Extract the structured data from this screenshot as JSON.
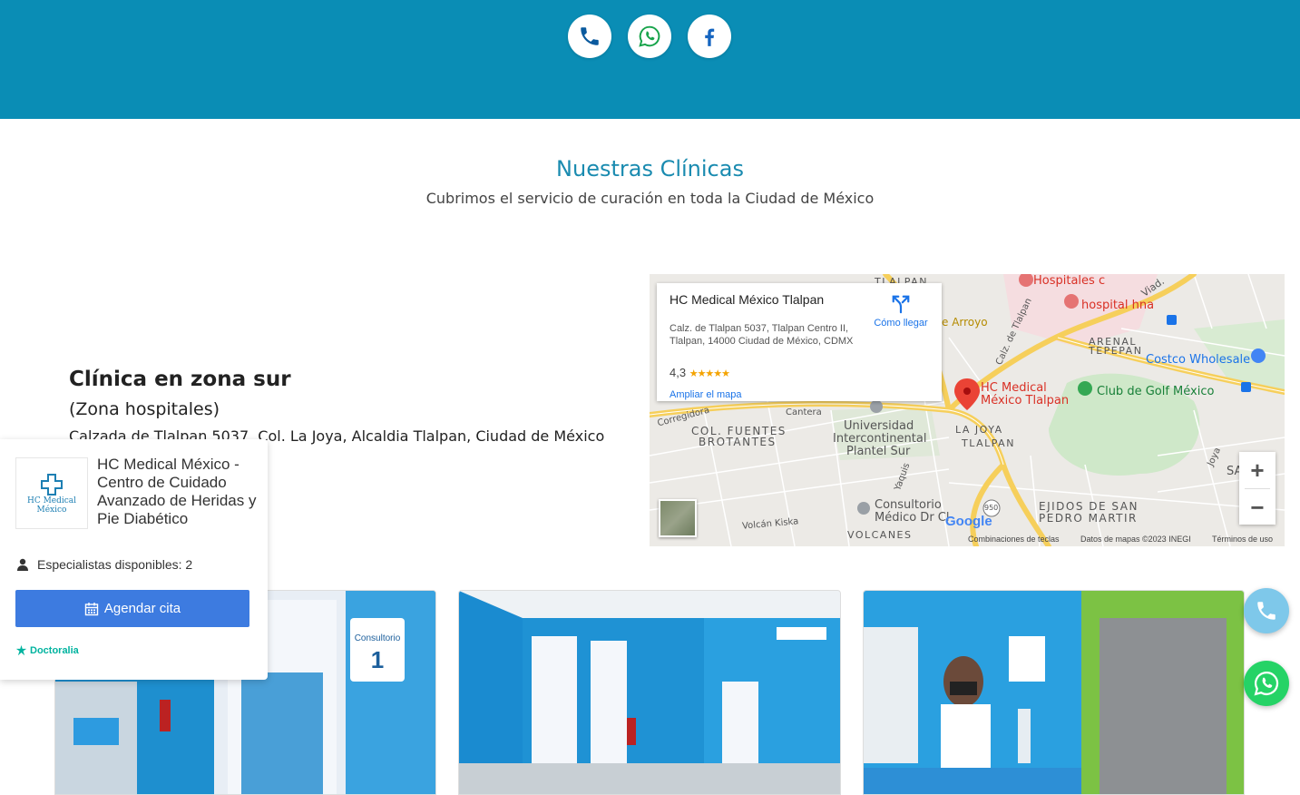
{
  "header": {
    "background_color": "#0a8db5",
    "social": [
      {
        "icon": "phone-icon",
        "label": "Teléfono"
      },
      {
        "icon": "whatsapp-icon",
        "label": "WhatsApp"
      },
      {
        "icon": "facebook-icon",
        "label": "Facebook"
      }
    ]
  },
  "section": {
    "title": "Nuestras Clínicas",
    "subtitle": "Cubrimos el servicio de curación en toda la Ciudad de México"
  },
  "clinic": {
    "name": "Clínica en zona sur",
    "zone": "(Zona hospitales)",
    "address": "Calzada de Tlalpan 5037, Col. La Joya, Alcaldia Tlalpan, Ciudad de México"
  },
  "map": {
    "card": {
      "place_name": "HC Medical México Tlalpan",
      "address": "Calz. de Tlalpan 5037, Tlalpan Centro II, Tlalpan, 14000 Ciudad de México, CDMX",
      "rating": "4,3",
      "stars": "★★★★★",
      "enlarge_link": "Ampliar el mapa",
      "directions_link": "Cómo llegar"
    },
    "labels": {
      "tlalpan_top": "TLALPAN",
      "hospitales": "Hospitales c",
      "hospital_hna": "hospital hna",
      "arroyo": "e Arroyo",
      "calz_tlalpan": "Calz. de Tlalpan",
      "arenal": "ARENAL",
      "tepepan": "TEPEPAN",
      "costco": "Costco Wholesale",
      "club_golf": "Club de Golf México",
      "hc_medical_1": "HC Medical",
      "hc_medical_2": "México Tlalpan",
      "corregidora": "Corregidora",
      "cantera": "Cantera",
      "col_fuentes": "COL. FUENTES",
      "brotantes": "BROTANTES",
      "universidad_1": "Universidad",
      "universidad_2": "Intercontinental",
      "universidad_3": "Plantel Sur",
      "la_joya": "LA JOYA",
      "tlalpan_mid": "TLALPAN",
      "yaquis": "Yaquis",
      "joya": "Joya",
      "consultorio_1": "Consultorio",
      "consultorio_2": "Médico Dr Cl",
      "volcan": "Volcán Kiska",
      "volcanes": "VOLCANES",
      "ejidos_1": "EJIDOS DE SAN",
      "ejidos_2": "PEDRO MARTIR",
      "route_950": "950",
      "viad": "Viad.",
      "sa": "SA",
      "google": "Google"
    },
    "footer": {
      "shortcuts": "Combinaciones de teclas",
      "data": "Datos de mapas ©2023 INEGI",
      "terms": "Términos de uso"
    },
    "zoom_in": "+",
    "zoom_out": "−"
  },
  "widget": {
    "logo_text_1": "HC Medical",
    "logo_text_2": "México",
    "clinic_name": "HC Medical México - Centro de Cuidado Avanzado de Heridas y Pie Diabético",
    "specialists": "Especialistas disponibles: 2",
    "book_button": "Agendar cita",
    "brand": "Doctoralia",
    "button_color": "#3d7be0",
    "brand_color": "#00b39f"
  },
  "photos": [
    {
      "alt": "Pasillo de consultorio 1",
      "sign": "Consultorio",
      "number": "1"
    },
    {
      "alt": "Pasillo con puertas HC Medical"
    },
    {
      "alt": "Recepción con asistente"
    }
  ],
  "floating": {
    "phone_color": "#7ec8ea",
    "whatsapp_color": "#25d366"
  }
}
